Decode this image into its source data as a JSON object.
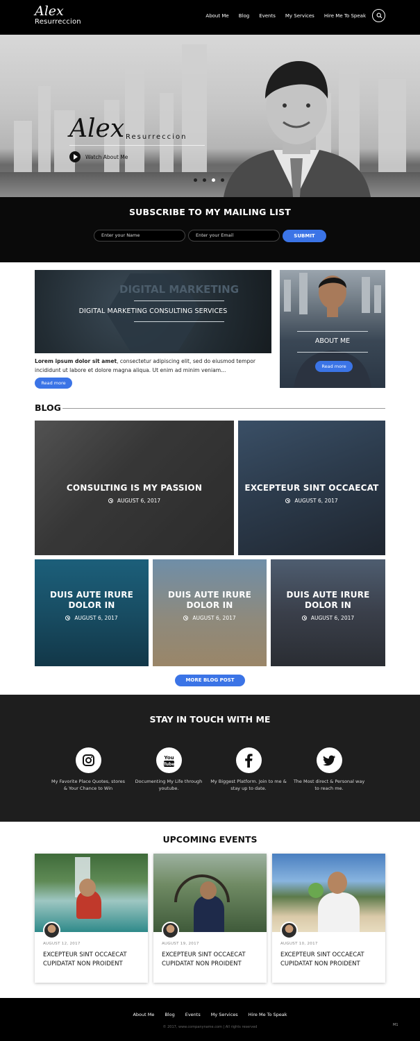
{
  "header": {
    "logo_script": "Alex",
    "logo_sub": "Resurreccion",
    "nav": [
      "About Me",
      "Blog",
      "Events",
      "My Services",
      "Hire Me To Speak"
    ]
  },
  "hero": {
    "name": "Alex",
    "surname": "Resurreccion",
    "watch_label": "Watch About Me",
    "slides": 4,
    "active_slide": 2
  },
  "subscribe": {
    "title": "SUBSCRIBE TO MY MAILING LIST",
    "name_placeholder": "Enter your Name",
    "email_placeholder": "Enter your Email",
    "submit_label": "SUBMIT"
  },
  "feature": {
    "ghost_text": "DIGITAL MARKETING",
    "title": "DIGITAL MARKETING CONSULTING SERVICES",
    "text_bold": "Lorem ipsum dolor sit amet",
    "text_rest": ", consectetur adipiscing elit, sed do eiusmod tempor incididunt ut labore et dolore magna aliqua. Ut enim ad minim veniam...",
    "read_more": "Read more"
  },
  "about_card": {
    "title": "ABOUT ME",
    "read_more": "Read more"
  },
  "blog": {
    "heading": "BLOG",
    "posts": [
      {
        "title": "CONSULTING IS MY PASSION",
        "date": "AUGUST 6, 2017"
      },
      {
        "title": "EXCEPTEUR SINT OCCAECAT",
        "date": "AUGUST 6, 2017"
      },
      {
        "title": "DUIS AUTE IRURE DOLOR IN",
        "date": "AUGUST 6, 2017"
      },
      {
        "title": "DUIS AUTE IRURE DOLOR IN",
        "date": "AUGUST 6, 2017"
      },
      {
        "title": "DUIS AUTE IRURE DOLOR IN",
        "date": "AUGUST 6, 2017"
      }
    ],
    "more_label": "MORE BLOG POST"
  },
  "touch": {
    "title": "STAY IN TOUCH WITH ME",
    "items": [
      {
        "icon": "instagram-icon",
        "text": "My Favorite Place Quotes, stores & Your Chance to Win"
      },
      {
        "icon": "youtube-icon",
        "text": "Documenting My Life through youtube."
      },
      {
        "icon": "facebook-icon",
        "text": "My Biggest Platform. Join to me & stay up to date."
      },
      {
        "icon": "twitter-icon",
        "text": "The Most direct & Personal way to reach me."
      }
    ]
  },
  "events": {
    "title": "UPCOMING EVENTS",
    "items": [
      {
        "date": "AUGUST 12, 2017",
        "title": "EXCEPTEUR SINT OCCAECAT CUPIDATAT NON PROIDENT"
      },
      {
        "date": "AUGUST 19, 2017",
        "title": "EXCEPTEUR SINT OCCAECAT CUPIDATAT NON PROIDENT"
      },
      {
        "date": "AUGUST 10, 2017",
        "title": "EXCEPTEUR SINT OCCAECAT CUPIDATAT NON PROIDENT"
      }
    ]
  },
  "footer": {
    "nav": [
      "About Me",
      "Blog",
      "Events",
      "My Services",
      "Hire Me To Speak"
    ],
    "copyright": "© 2017, www.companyname.com  |  All rights reserved",
    "mark": "M1"
  },
  "colors": {
    "accent": "#3b74e6",
    "dark": "#000000",
    "section_dark": "#1e1e1e"
  }
}
